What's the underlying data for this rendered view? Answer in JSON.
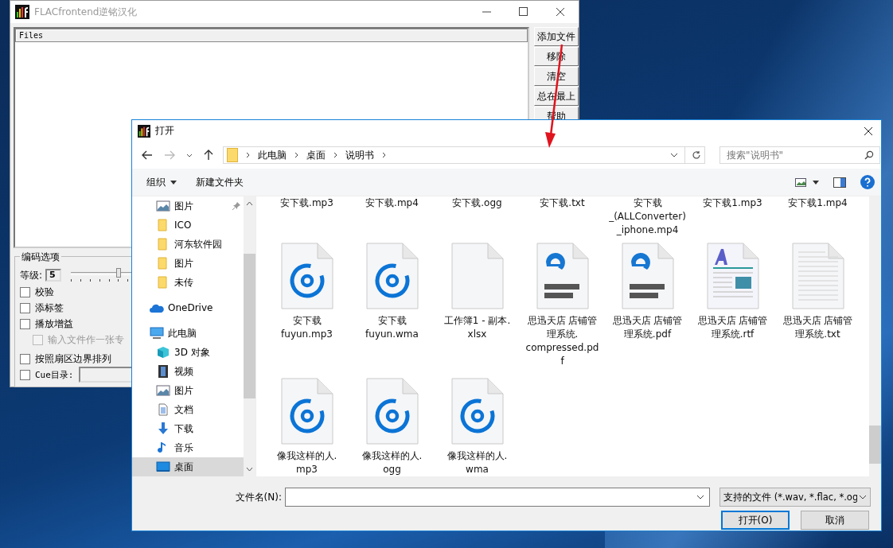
{
  "back_window": {
    "title": "FLACfrontend逆铭汉化",
    "list_header": "Files",
    "buttons": [
      "添加文件",
      "移除",
      "清空",
      "总在最上",
      "帮助"
    ],
    "group": {
      "legend": "编码选项",
      "level_label": "等级:",
      "level_value": "5",
      "slider": {
        "level": 0.625
      },
      "options": [
        {
          "label": "校验",
          "kind": "check",
          "checked": false,
          "disabled": false
        },
        {
          "label": "添标签",
          "kind": "check",
          "checked": false,
          "disabled": false
        },
        {
          "label": "播放增益",
          "kind": "check",
          "checked": false,
          "disabled": false,
          "children": [
            {
              "label": "输入文件作一张专",
              "kind": "check",
              "checked": false,
              "disabled": true
            }
          ]
        },
        {
          "label": "按照扇区边界排列",
          "kind": "check",
          "checked": false,
          "disabled": false
        },
        {
          "label": "Cue目录:",
          "kind": "field",
          "checked": false,
          "disabled": false
        }
      ]
    }
  },
  "dialog": {
    "title": "打开",
    "breadcrumb": [
      "此电脑",
      "桌面",
      "说明书"
    ],
    "search": {
      "placeholder": "搜索\"说明书\""
    },
    "toolbar": {
      "organize": "组织",
      "new_folder": "新建文件夹"
    },
    "sidebar": {
      "items": [
        {
          "children": [
            {
              "label": "图片",
              "kind": "picture",
              "pinned": true,
              "selected": false
            },
            {
              "label": "ICO",
              "kind": "folder",
              "pinned": false,
              "selected": false
            },
            {
              "label": "河东软件园",
              "kind": "folder",
              "pinned": false,
              "selected": false
            },
            {
              "label": "图片",
              "kind": "folder",
              "pinned": false,
              "selected": false
            },
            {
              "label": "未传",
              "kind": "folder",
              "pinned": false,
              "selected": false
            }
          ]
        },
        {
          "label": "OneDrive",
          "kind": "cloud",
          "pinned": false,
          "selected": false
        },
        {
          "label": "此电脑",
          "kind": "pc",
          "pinned": false,
          "selected": false,
          "children": [
            {
              "label": "3D 对象",
              "kind": "cube",
              "pinned": false,
              "selected": false
            },
            {
              "label": "视频",
              "kind": "film",
              "pinned": false,
              "selected": false
            },
            {
              "label": "图片",
              "kind": "picture",
              "pinned": false,
              "selected": false
            },
            {
              "label": "文档",
              "kind": "doc",
              "pinned": false,
              "selected": false
            },
            {
              "label": "下载",
              "kind": "download",
              "pinned": false,
              "selected": false
            },
            {
              "label": "音乐",
              "kind": "music",
              "pinned": false,
              "selected": false
            },
            {
              "label": "桌面",
              "kind": "desktop",
              "pinned": false,
              "selected": true
            }
          ]
        }
      ]
    },
    "files": {
      "partial_row": [
        "安下载.mp3",
        "安下载.mp4",
        "安下载.ogg",
        "安下载.txt",
        "安下载\n_(ALLConverter)\n_iphone.mp4",
        "安下载1.mp3",
        "安下载1.mp4"
      ],
      "items": [
        {
          "name": "安下载\nfuyun.mp3",
          "kind": "music"
        },
        {
          "name": "安下载\nfuyun.wma",
          "kind": "music"
        },
        {
          "name": "工作簿1 - 副本.\nxlsx",
          "kind": "file"
        },
        {
          "name": "思迅天店 店铺管理系统.\ncompressed.pdf",
          "kind": "pdf"
        },
        {
          "name": "思迅天店 店铺管理系统.pdf",
          "kind": "pdf"
        },
        {
          "name": "思迅天店 店铺管理系统.rtf",
          "kind": "rtf"
        },
        {
          "name": "思迅天店 店铺管理系统.txt",
          "kind": "txt"
        },
        {
          "name": "像我这样的人.\nmp3",
          "kind": "music"
        },
        {
          "name": "像我这样的人.\nogg",
          "kind": "music"
        },
        {
          "name": "像我这样的人.\nwma",
          "kind": "music"
        }
      ]
    },
    "filename": {
      "label": "文件名(N):"
    },
    "filter": "支持的文件 (*.wav, *.flac, *.og",
    "buttons": [
      {
        "label": "打开(O)",
        "kind": "primary"
      },
      {
        "label": "取消",
        "kind": "normal"
      }
    ]
  }
}
